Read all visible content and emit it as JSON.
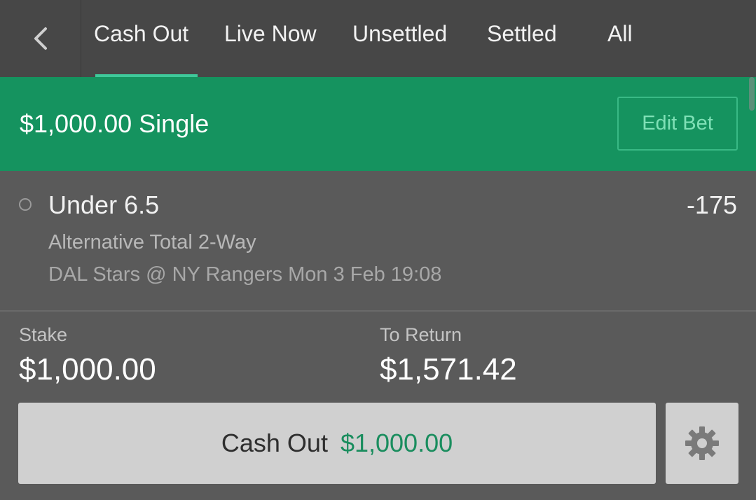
{
  "nav": {
    "back_icon": "chevron-left-icon",
    "tabs": [
      {
        "label": "Cash Out",
        "active": true
      },
      {
        "label": "Live Now",
        "active": false
      },
      {
        "label": "Unsettled",
        "active": false
      },
      {
        "label": "Settled",
        "active": false
      },
      {
        "label": "All",
        "active": false
      }
    ]
  },
  "bet": {
    "title": "$1,000.00 Single",
    "edit_label": "Edit Bet",
    "selection": {
      "name": "Under 6.5",
      "odds": "-175",
      "market": "Alternative Total 2-Way",
      "event": "DAL Stars @ NY Rangers Mon 3 Feb 19:08"
    },
    "stake": {
      "label": "Stake",
      "value": "$1,000.00"
    },
    "to_return": {
      "label": "To Return",
      "value": "$1,571.42"
    },
    "cashout": {
      "label": "Cash Out",
      "amount": "$1,000.00"
    },
    "settings_icon": "gear-icon"
  },
  "colors": {
    "accent_green": "#15935f",
    "tab_underline": "#3ec99a",
    "cashout_amount": "#1a8d5e",
    "edit_text": "#7fe0b6"
  }
}
